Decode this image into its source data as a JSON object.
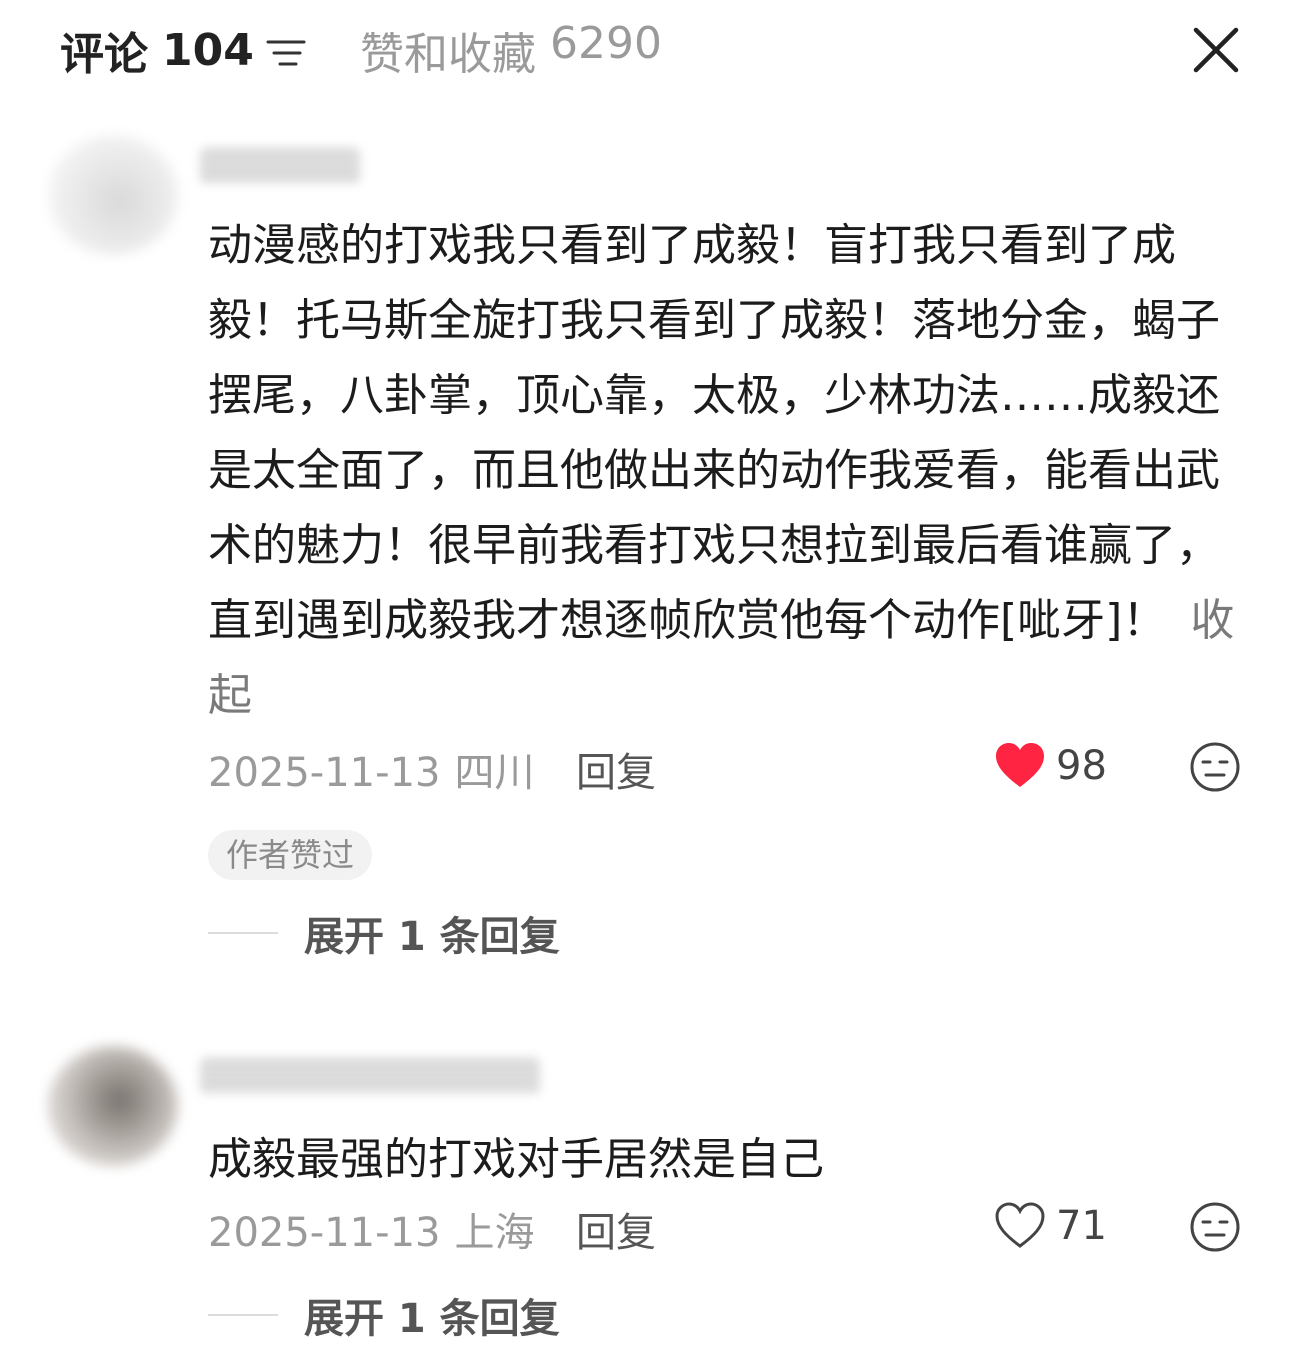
{
  "header": {
    "comments_tab_label": "评论",
    "comments_count": "104",
    "likes_tab_label": "赞和收藏",
    "likes_count": "6290"
  },
  "comments": [
    {
      "text": "动漫感的打戏我只看到了成毅！盲打我只看到了成毅！托马斯全旋打我只看到了成毅！落地分金，蝎子摆尾，八卦掌，顶心靠，太极，少林功法……成毅还是太全面了，而且他做出来的动作我爱看，能看出武术的魅力！很早前我看打戏只想拉到最后看谁赢了，直到遇到成毅我才想逐帧欣赏他每个动作[呲牙]！",
      "collapse_label": "收起",
      "date": "2025-11-13",
      "location": "四川",
      "reply_label": "回复",
      "like_count": "98",
      "liked": true,
      "heart_color": "#ff2442",
      "badge": "作者赞过",
      "expand_label": "展开 1 条回复"
    },
    {
      "text": "成毅最强的打戏对手居然是自己",
      "date": "2025-11-13",
      "location": "上海",
      "reply_label": "回复",
      "like_count": "71",
      "liked": false,
      "expand_label": "展开 1 条回复"
    }
  ]
}
